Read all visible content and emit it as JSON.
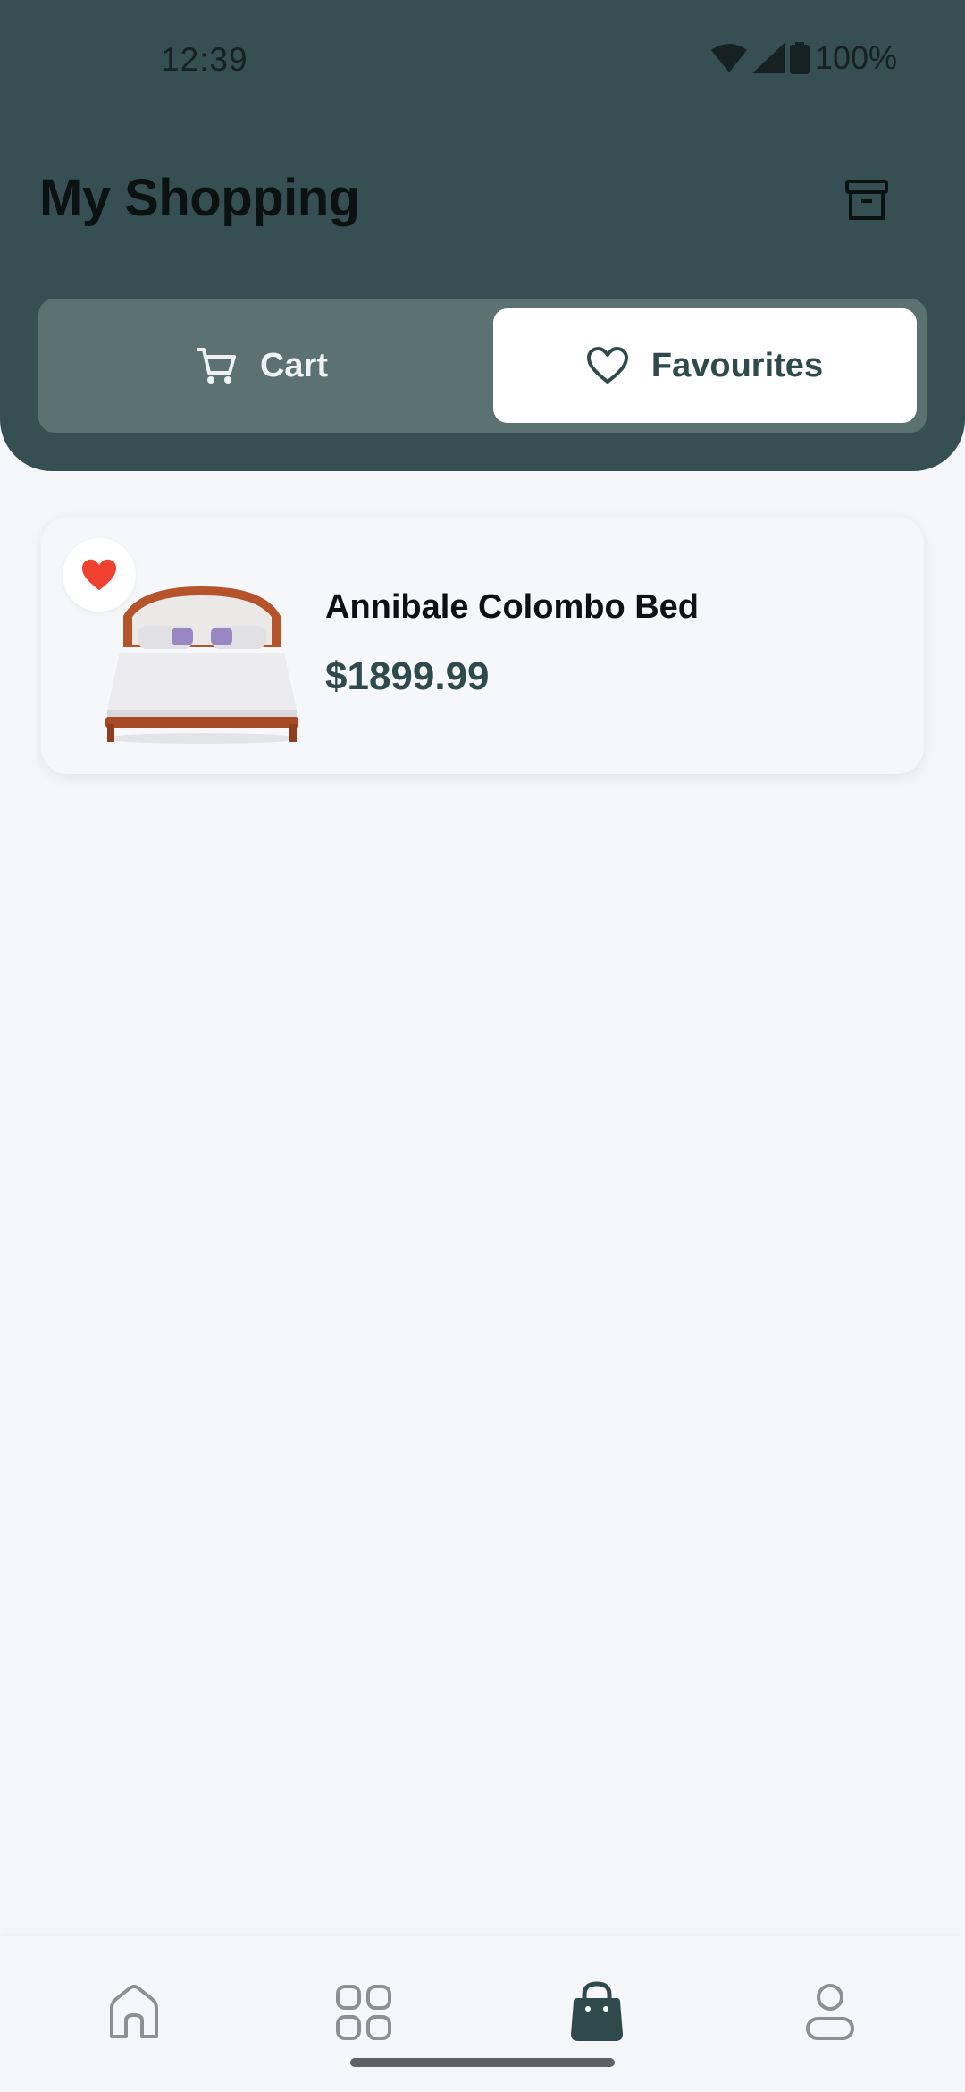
{
  "status_bar": {
    "time": "12:39",
    "battery": "100%"
  },
  "header": {
    "title": "My Shopping",
    "archive_icon": "archive-icon"
  },
  "tabs": [
    {
      "label": "Cart",
      "icon": "cart-icon",
      "selected": false
    },
    {
      "label": "Favourites",
      "icon": "heart-outline-icon",
      "selected": true
    }
  ],
  "favourites": [
    {
      "name": "Annibale Colombo Bed",
      "price": "$1899.99",
      "favourited": true
    }
  ],
  "bottom_nav": [
    {
      "icon": "home-icon",
      "selected": false
    },
    {
      "icon": "grid-icon",
      "selected": false
    },
    {
      "icon": "shopping-bag-icon",
      "selected": true
    },
    {
      "icon": "profile-icon",
      "selected": false
    }
  ],
  "colors": {
    "header": "#364f52",
    "accent": "#2f4a4d",
    "favourite_heart": "#f0402f",
    "background": "#f4f6fa"
  }
}
